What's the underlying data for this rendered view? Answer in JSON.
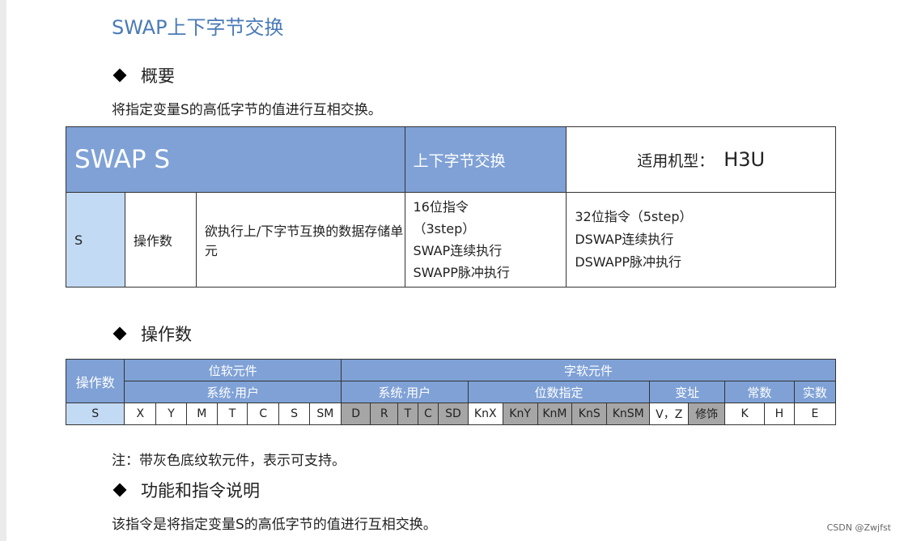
{
  "title": "SWAP上下字节交换",
  "sections": {
    "overview": {
      "heading": "概要",
      "text": "将指定变量S的高低字节的值进行互相交换。"
    },
    "operand": {
      "heading": "操作数"
    },
    "note": "注：带灰色底纹软元件，表示可支持。",
    "function": {
      "heading": "功能和指令说明",
      "text": "该指令是将指定变量S的高低字节的值进行互相交换。"
    }
  },
  "instruction_table": {
    "instr": "SWAP  S",
    "desc": "上下字节交换",
    "model_label": "适用机型：",
    "model_value": "H3U",
    "row": {
      "operand": "S",
      "type": "操作数",
      "description": "欲执行上/下字节互换的数据存储单元",
      "bit16": [
        "16位指令",
        "（3step）",
        "SWAP连续执行",
        "SWAPP脉冲执行"
      ],
      "bit32": [
        "32位指令（5step）",
        "DSWAP连续执行",
        "DSWAPP脉冲执行"
      ]
    }
  },
  "operand_table": {
    "corner": "操作数",
    "group_bit": "位软元件",
    "group_word": "字软元件",
    "sub_bit_sys": "系统·用户",
    "sub_word_sys": "系统·用户",
    "sub_word_bit": "位数指定",
    "sub_word_addr": "变址",
    "sub_const": "常数",
    "sub_real": "实数",
    "row_label": "S",
    "cells": [
      {
        "label": "X",
        "supported": false
      },
      {
        "label": "Y",
        "supported": false
      },
      {
        "label": "M",
        "supported": false
      },
      {
        "label": "T",
        "supported": false
      },
      {
        "label": "C",
        "supported": false
      },
      {
        "label": "S",
        "supported": false
      },
      {
        "label": "SM",
        "supported": false
      },
      {
        "label": "D",
        "supported": true
      },
      {
        "label": "R",
        "supported": true
      },
      {
        "label": "T",
        "supported": true
      },
      {
        "label": "C",
        "supported": true
      },
      {
        "label": "SD",
        "supported": true
      },
      {
        "label": "KnX",
        "supported": false
      },
      {
        "label": "KnY",
        "supported": true
      },
      {
        "label": "KnM",
        "supported": true
      },
      {
        "label": "KnS",
        "supported": true
      },
      {
        "label": "KnSM",
        "supported": true
      },
      {
        "label": "V，Z",
        "supported": false
      },
      {
        "label": "修饰",
        "supported": true
      },
      {
        "label": "K",
        "supported": false
      },
      {
        "label": "H",
        "supported": false
      },
      {
        "label": "E",
        "supported": false
      }
    ]
  },
  "watermark": "CSDN @Zwjfst",
  "colors": {
    "title": "#4a7ab8",
    "header_blue": "#7fa1d6",
    "light_blue": "#c3daf4",
    "grey": "#a6a6a6"
  }
}
